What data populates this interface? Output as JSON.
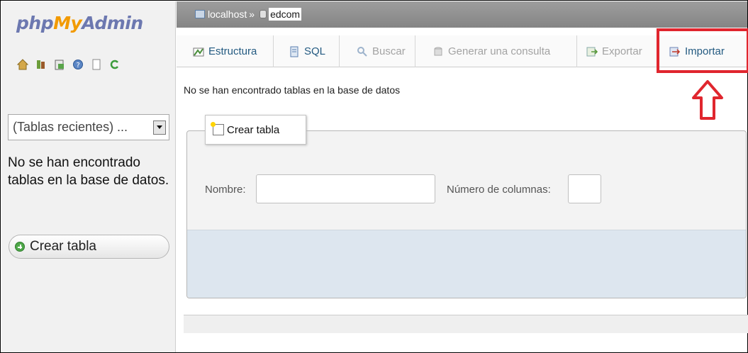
{
  "sidebar": {
    "logo": {
      "php": "php",
      "my": "My",
      "admin": "Admin"
    },
    "nav_icons": [
      "home-icon",
      "db-icon",
      "sql-icon",
      "help-icon",
      "doc-icon",
      "refresh-icon"
    ],
    "recent_select": "(Tablas recientes) ...",
    "no_tables_msg": "No se han encontrado tablas en la base de datos.",
    "create_table_label": "Crear tabla"
  },
  "breadcrumb": {
    "server": "localhost",
    "separator": "»",
    "database": "edcom"
  },
  "tabs": [
    {
      "label": "Estructura",
      "icon": "structure-icon",
      "state": "active"
    },
    {
      "label": "SQL",
      "icon": "sql-icon",
      "state": "active"
    },
    {
      "label": "Buscar",
      "icon": "search-icon",
      "state": "disabled"
    },
    {
      "label": "Generar una consulta",
      "icon": "query-icon",
      "state": "disabled"
    },
    {
      "label": "Exportar",
      "icon": "export-icon",
      "state": "disabled"
    },
    {
      "label": "Importar",
      "icon": "import-icon",
      "state": "highlighted"
    }
  ],
  "main": {
    "no_tables_msg": "No se han encontrado tablas en la base de datos",
    "create_table": {
      "legend": "Crear tabla",
      "name_label": "Nombre:",
      "name_value": "",
      "columns_label": "Número de columnas:",
      "columns_value": ""
    }
  },
  "colors": {
    "highlight": "#e0262e",
    "link": "#235a81",
    "logo_blue": "#6c78b0",
    "logo_orange": "#f29a00"
  }
}
